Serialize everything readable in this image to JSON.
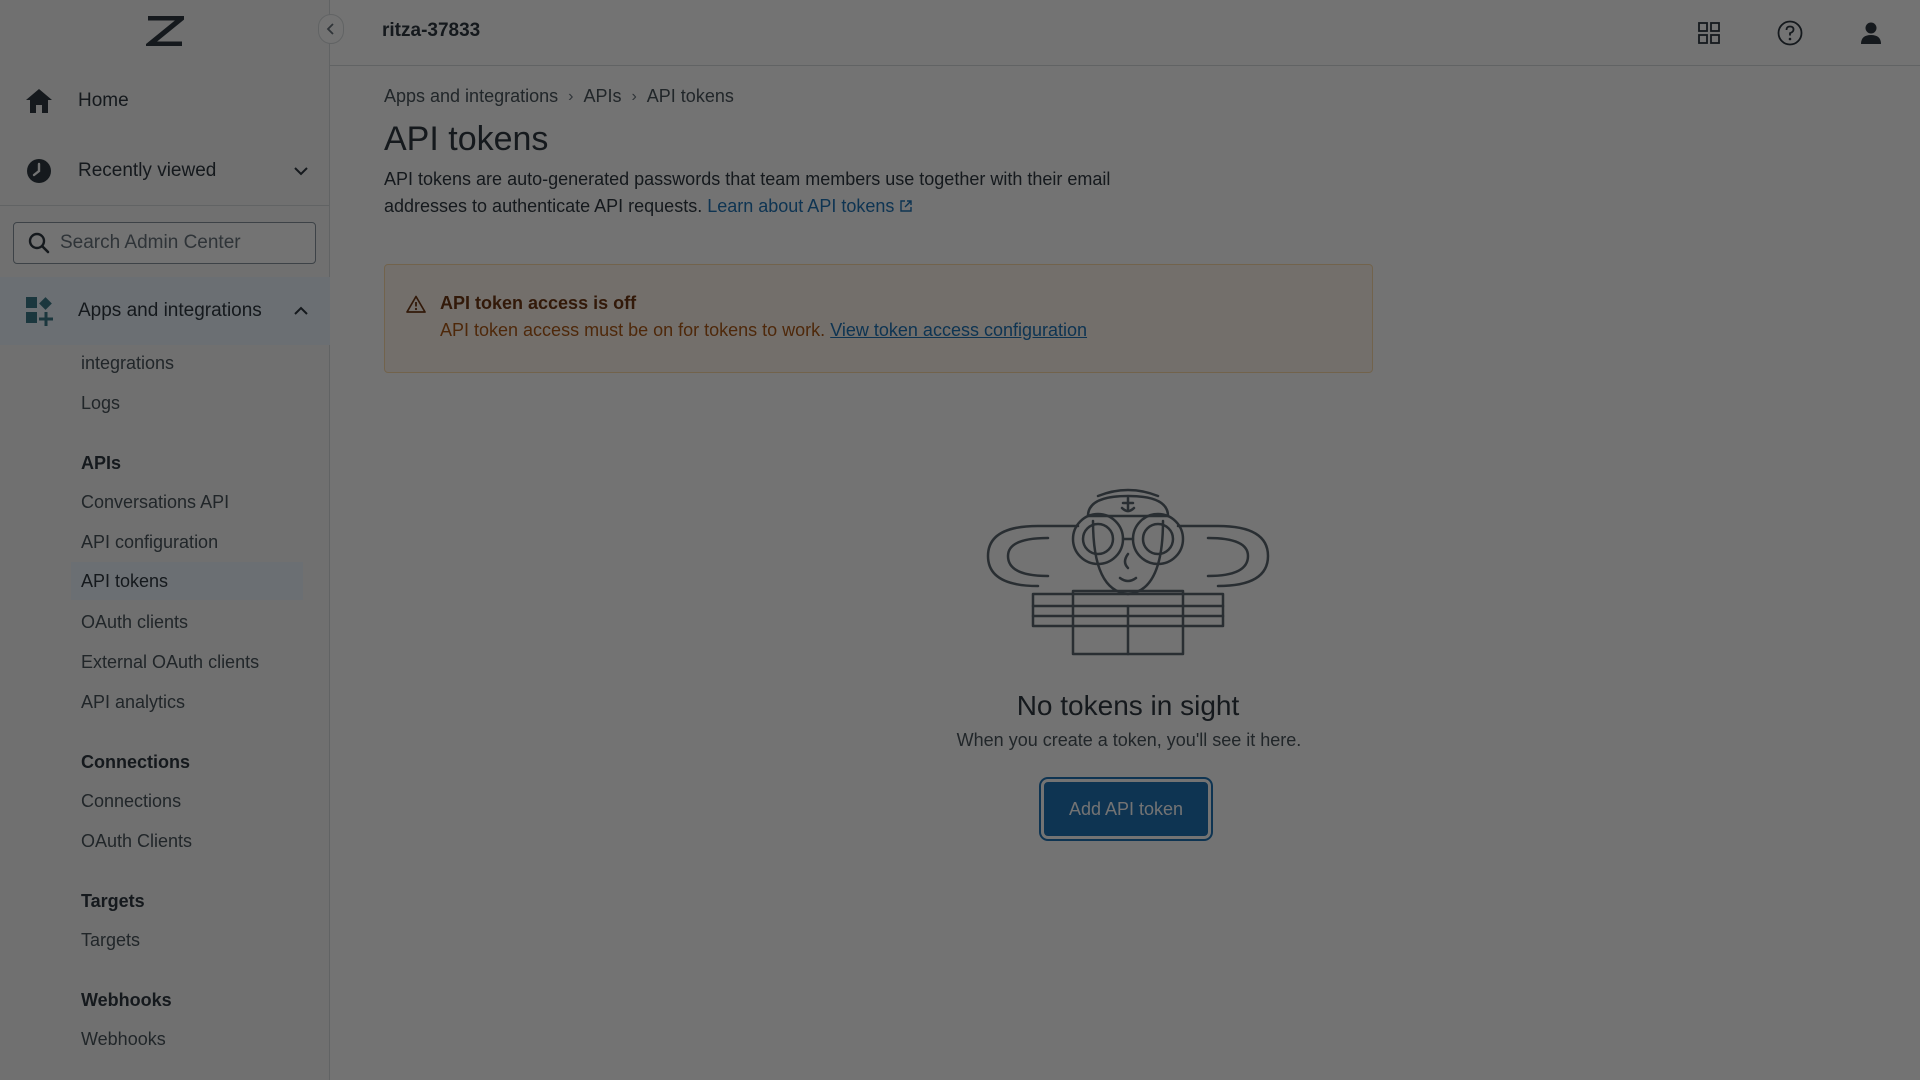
{
  "header": {
    "account": "ritza-37833"
  },
  "sidebar": {
    "nav": [
      {
        "label": "Home",
        "icon": "home-icon"
      },
      {
        "label": "Recently viewed",
        "icon": "clock-icon"
      }
    ],
    "search_placeholder": "Search Admin Center",
    "active_section": {
      "label": "Apps and integrations",
      "icon": "apps-add-icon"
    },
    "groups": {
      "partial_top": [
        "integrations",
        "Logs"
      ],
      "apis": {
        "heading": "APIs",
        "items": [
          "Conversations API",
          "API configuration",
          "API tokens",
          "OAuth clients",
          "External OAuth clients",
          "API analytics"
        ]
      },
      "connections": {
        "heading": "Connections",
        "items": [
          "Connections",
          "OAuth Clients"
        ]
      },
      "targets": {
        "heading": "Targets",
        "items": [
          "Targets"
        ]
      },
      "webhooks": {
        "heading": "Webhooks",
        "items": [
          "Webhooks"
        ]
      }
    },
    "selected_item": "API tokens"
  },
  "breadcrumb": [
    "Apps and integrations",
    "APIs",
    "API tokens"
  ],
  "page": {
    "title": "API tokens",
    "description": "API tokens are auto-generated passwords that team members use together with their email addresses to authenticate API requests.",
    "learn_link": "Learn about API tokens"
  },
  "notice": {
    "title": "API token access is off",
    "body": "API token access must be on for tokens to work.",
    "link": "View token access configuration"
  },
  "empty_state": {
    "title": "No tokens in sight",
    "subtitle": "When you create a token, you'll see it here.",
    "button": "Add API token"
  },
  "colors": {
    "primary": "#1f73b7",
    "notice_bg": "#fff7ed",
    "notice_title": "#703815",
    "notice_text": "#ad5918",
    "active_bg": "#edf7ff"
  }
}
